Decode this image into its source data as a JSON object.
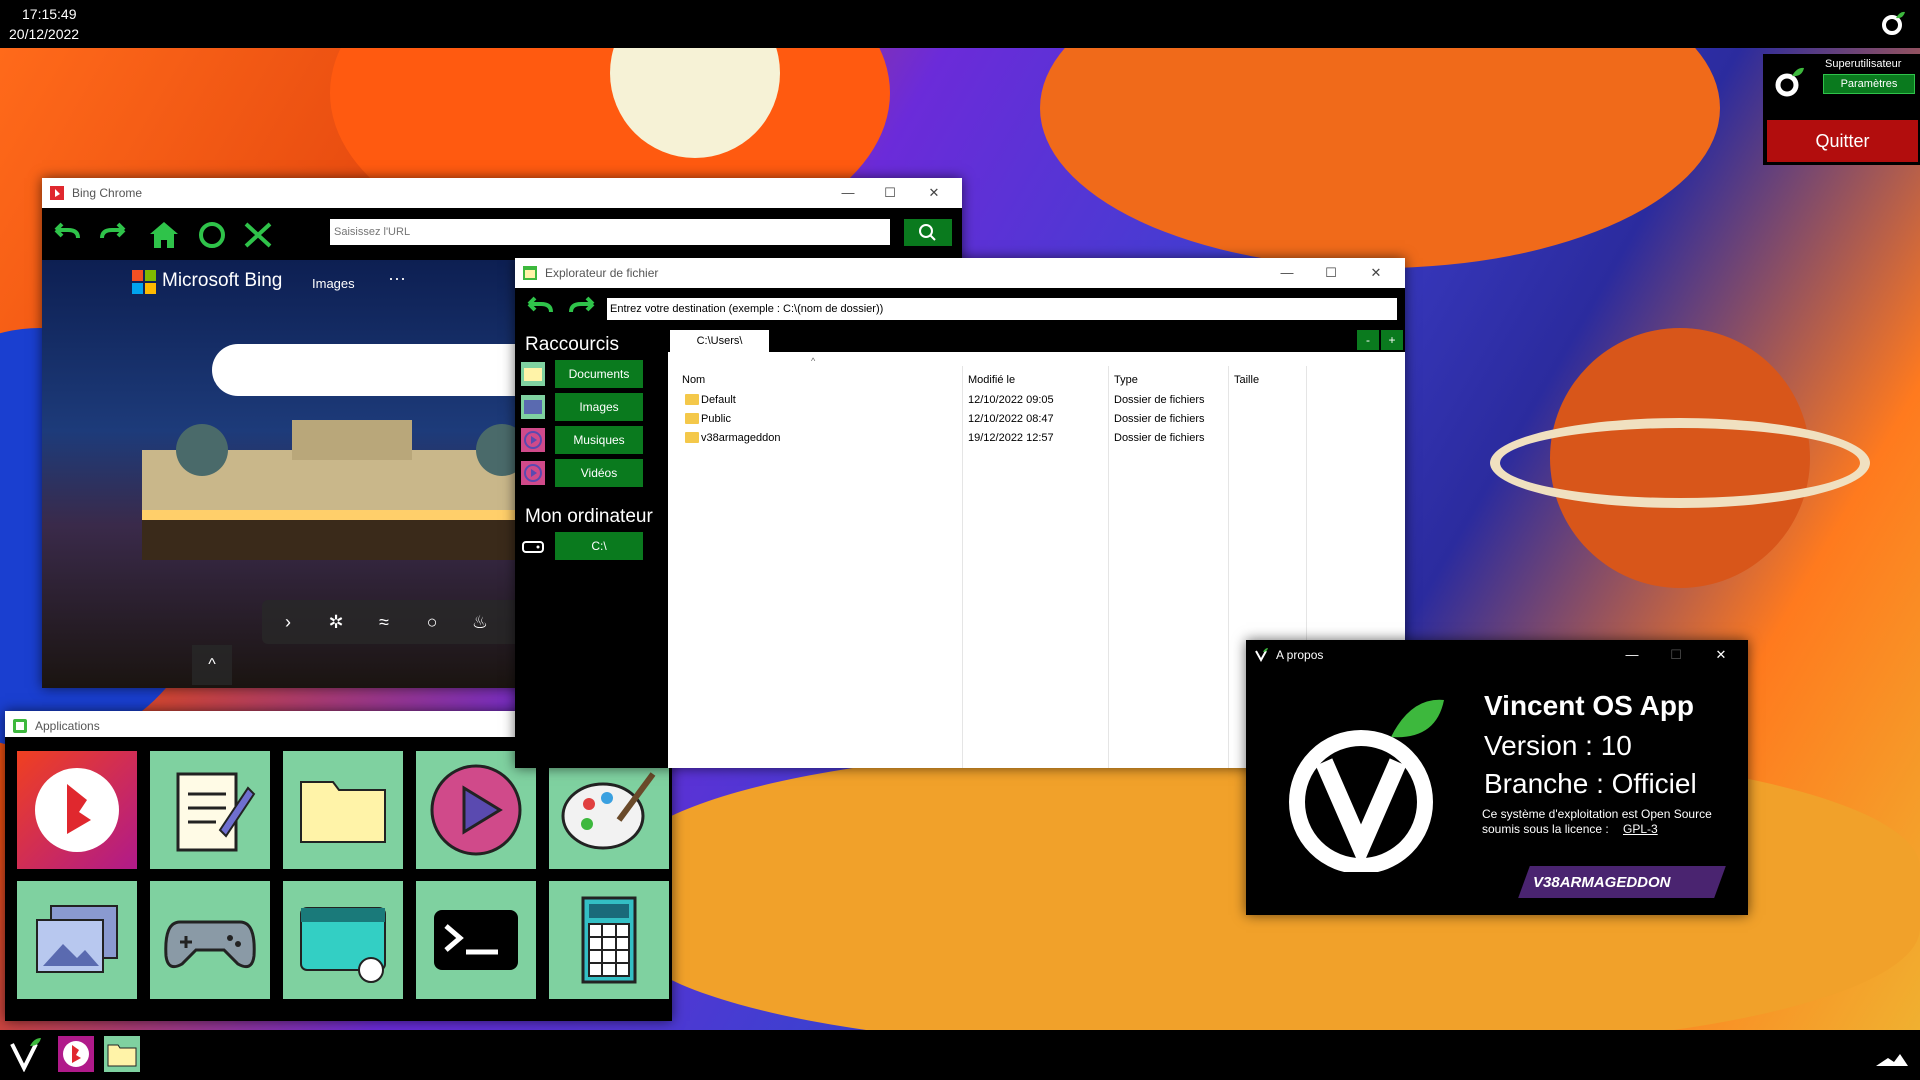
{
  "clock": {
    "time": "17:15:49",
    "date": "20/12/2022"
  },
  "user": {
    "name": "Superutilisateur",
    "settings_label": "Paramètres",
    "quit_label": "Quitter"
  },
  "browser": {
    "title": "Bing Chrome",
    "url_placeholder": "Saisissez l'URL",
    "page": {
      "brand": "Microsoft Bing",
      "nav_images": "Images",
      "more": "···"
    }
  },
  "explorer": {
    "title": "Explorateur de fichier",
    "destination_value": "Entrez votre destination (exemple : C:\\(nom de dossier))",
    "shortcuts_heading": "Raccourcis",
    "shortcuts": [
      "Documents",
      "Images",
      "Musiques",
      "Vidéos"
    ],
    "computer_heading": "Mon ordinateur",
    "drive": "C:\\",
    "current_tab": "C:\\Users\\",
    "tab_remove": "-",
    "tab_add": "+",
    "columns": {
      "name": "Nom",
      "modified": "Modifié le",
      "type": "Type",
      "size": "Taille"
    },
    "rows": [
      {
        "name": "Default",
        "modified": "12/10/2022 09:05",
        "type": "Dossier de fichiers",
        "size": ""
      },
      {
        "name": "Public",
        "modified": "12/10/2022 08:47",
        "type": "Dossier de fichiers",
        "size": ""
      },
      {
        "name": "v38armageddon",
        "modified": "19/12/2022 12:57",
        "type": "Dossier de fichiers",
        "size": ""
      }
    ]
  },
  "applications": {
    "title": "Applications",
    "icons": [
      "bing-icon",
      "notepad-icon",
      "folder-icon",
      "media-player-icon",
      "paint-palette-icon",
      "photos-icon",
      "gamepad-icon",
      "browser-window-icon",
      "terminal-icon",
      "calculator-icon"
    ]
  },
  "about": {
    "title": "A propos",
    "app_name": "Vincent OS App",
    "version": "Version : 10",
    "branch": "Branche : Officiel",
    "description": "Ce système d'exploitation est Open Source",
    "license_label": "soumis sous la licence :",
    "license": "GPL-3",
    "badge": "V38ARMAGEDDON"
  },
  "window_controls": {
    "minimize": "—",
    "maximize": "☐",
    "close": "✕"
  },
  "colors": {
    "accent_green": "#0a7a1e",
    "quit_red": "#b20d0d",
    "badge_purple": "#4a2470",
    "tile_green": "#7fd1a0"
  }
}
